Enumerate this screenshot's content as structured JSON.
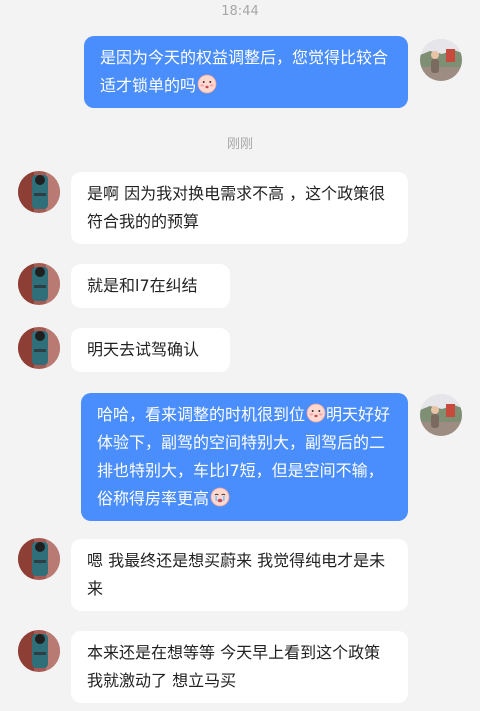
{
  "timestamps": [
    "18:44",
    "刚刚"
  ],
  "messages": [
    {
      "side": "out",
      "text": "是因为今天的权益调整后，您觉得比较合适才锁单的吗",
      "trailing_icon": "blushing-face-emoji"
    },
    {
      "side": "in",
      "text": "是啊  因为我对换电需求不高 ，这个政策很符合我的的预算"
    },
    {
      "side": "in",
      "text": "就是和l7在纠结"
    },
    {
      "side": "in",
      "text": "明天去试驾确认"
    },
    {
      "side": "out",
      "parts": [
        "哈哈，看来调整的时机很到位",
        "明天好好体验下，副驾的空间特别大，副驾后的二排也特别大，车比l7短，但是空间不输，俗称得房率更高"
      ],
      "inline_icons": [
        "blushing-face-emoji",
        "crying-face-emoji"
      ]
    },
    {
      "side": "in",
      "text": "嗯 我最终还是想买蔚来 我觉得纯电才是未来"
    },
    {
      "side": "in",
      "text": "本来还是在想等等  今天早上看到这个政策我就激动了 想立马买"
    }
  ],
  "colors": {
    "background": "#f3f3f3",
    "outgoing_bubble": "#4a8dfc",
    "incoming_bubble": "#ffffff",
    "timestamp_text": "#a7a7a7"
  }
}
